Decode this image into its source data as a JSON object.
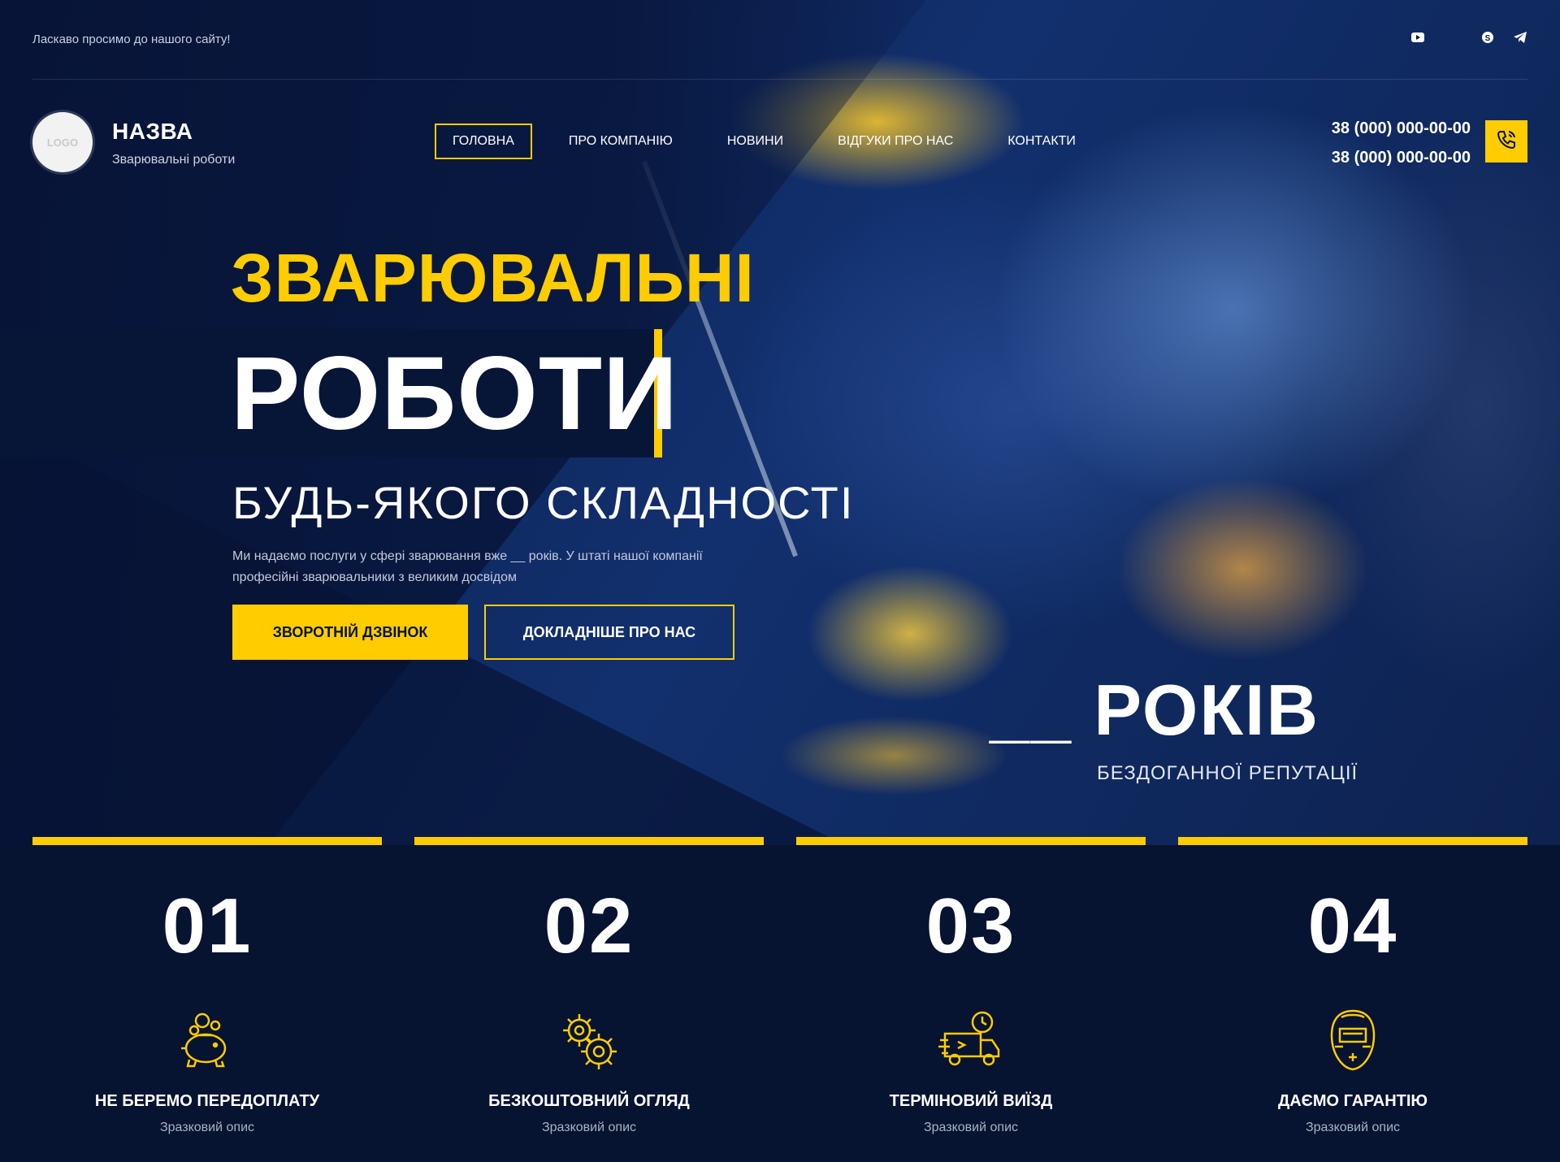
{
  "colors": {
    "accent": "#ffcc00",
    "background": "#061331",
    "text": "#ffffff"
  },
  "topbar": {
    "welcome": "Ласкаво просимо до нашого сайту!",
    "socials": [
      "youtube-icon",
      "skype-icon",
      "telegram-icon"
    ]
  },
  "header": {
    "logo_text": "LOGO",
    "brand_name": "НАЗВА",
    "brand_sub": "Зварювальні роботи",
    "nav": [
      {
        "label": "ГОЛОВНА",
        "active": true
      },
      {
        "label": "ПРО КОМПАНІЮ",
        "active": false
      },
      {
        "label": "НОВИНИ",
        "active": false
      },
      {
        "label": "ВІДГУКИ ПРО НАС",
        "active": false
      },
      {
        "label": "КОНТАКТИ",
        "active": false
      }
    ],
    "phones": [
      "38 (000) 000-00-00",
      "38 (000) 000-00-00"
    ]
  },
  "hero": {
    "line1": "ЗВАРЮВАЛЬНІ",
    "line2": "РОБОТИ",
    "line3": "БУДЬ-ЯКОГО СКЛАДНОСТІ",
    "description": "Ми надаємо послуги у сфері зварювання вже __ років. У штаті нашої компанії професійні зварювальники з великим досвідом",
    "btn_primary": "ЗВОРОТНІЙ ДЗВІНОК",
    "btn_secondary": "ДОКЛАДНІШЕ ПРО НАС",
    "years_number": "__ РОКІВ",
    "years_sub": "БЕЗДОГАННОЇ РЕПУТАЦІЇ"
  },
  "features": [
    {
      "num": "01",
      "title": "НЕ БЕРЕМО ПЕРЕДОПЛАТУ",
      "desc": "Зразковий опис",
      "icon": "piggy-bank-icon"
    },
    {
      "num": "02",
      "title": "БЕЗКОШТОВНИЙ ОГЛЯД",
      "desc": "Зразковий опис",
      "icon": "gears-icon"
    },
    {
      "num": "03",
      "title": "ТЕРМІНОВИЙ ВИЇЗД",
      "desc": "Зразковий опис",
      "icon": "fast-truck-icon"
    },
    {
      "num": "04",
      "title": "ДАЄМО ГАРАНТІЮ",
      "desc": "Зразковий опис",
      "icon": "welding-mask-icon"
    }
  ]
}
